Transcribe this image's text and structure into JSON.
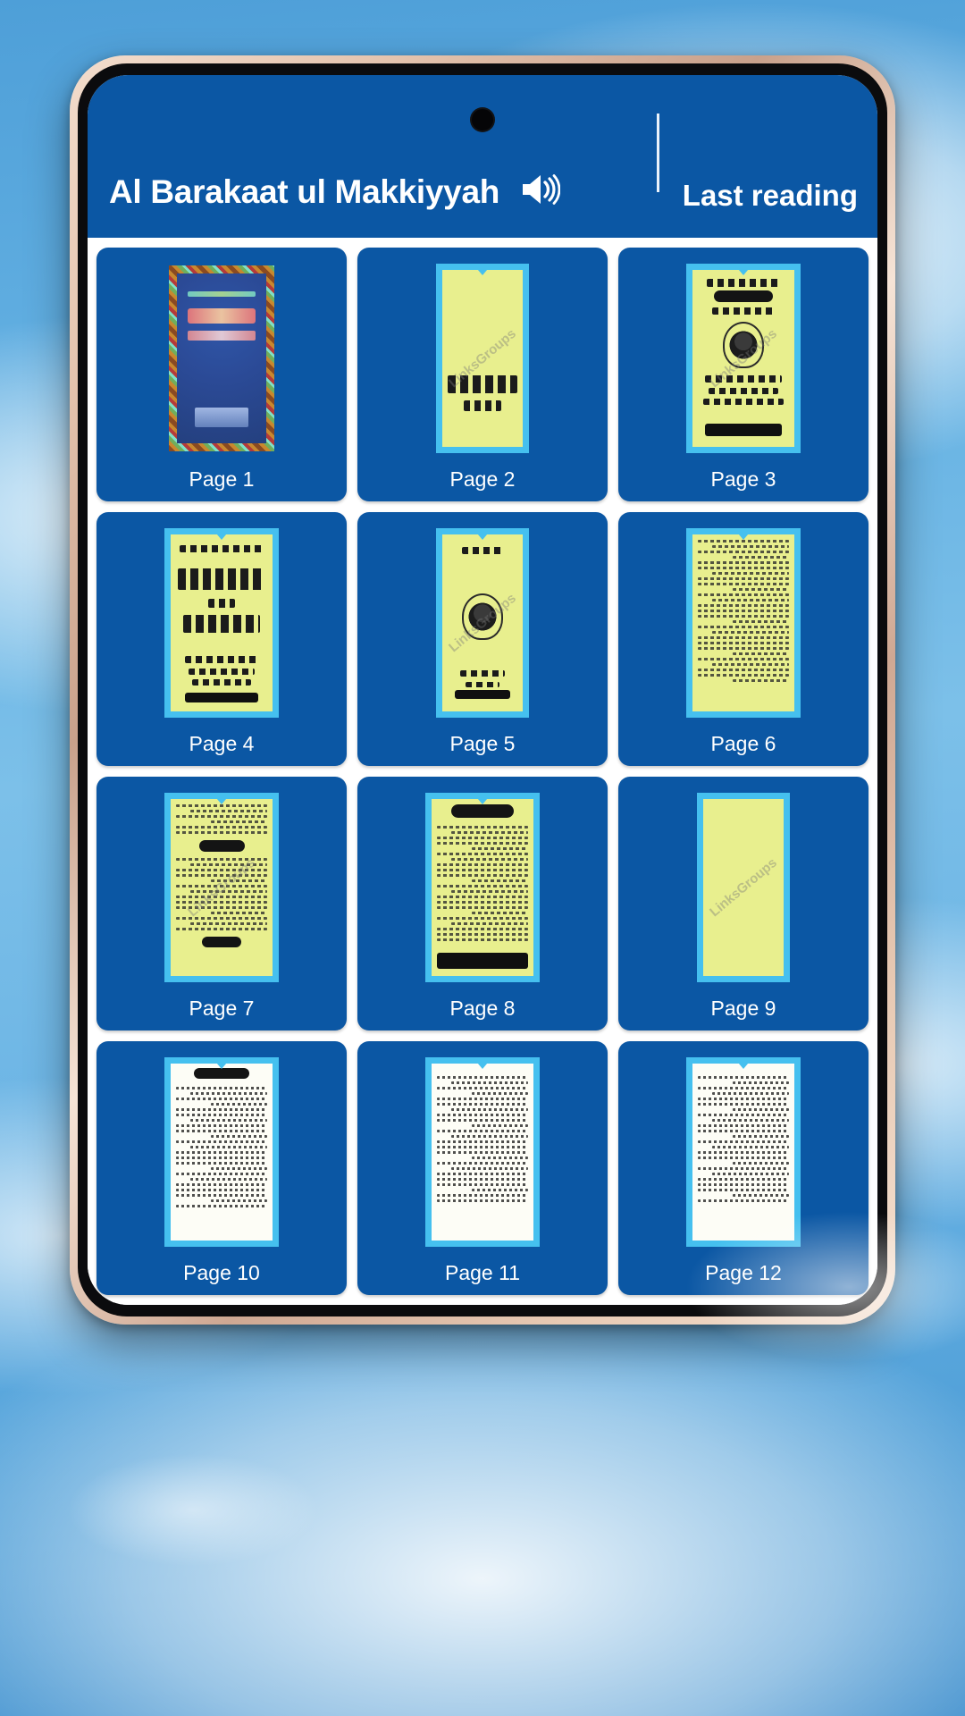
{
  "app": {
    "title": "Al Barakaat ul Makkiyyah",
    "speaker_icon": "speaker-icon",
    "last_reading_label": "Last reading",
    "header_bg": "#0b57a4",
    "card_bg": "#0b57a4",
    "label_color": "#ffffff",
    "page_bg": "#ffffff"
  },
  "grid": {
    "columns": 3,
    "items": [
      {
        "label": "Page 1",
        "thumb": "ornate-book-cover",
        "watermark": ""
      },
      {
        "label": "Page 2",
        "thumb": "title-page-sparse",
        "watermark": "LinksGroups"
      },
      {
        "label": "Page 3",
        "thumb": "emblem-title-page",
        "watermark": "LinksGroups"
      },
      {
        "label": "Page 4",
        "thumb": "arabic-title-page",
        "watermark": ""
      },
      {
        "label": "Page 5",
        "thumb": "emblem-page",
        "watermark": "LinksGroups"
      },
      {
        "label": "Page 6",
        "thumb": "dense-text-page",
        "watermark": ""
      },
      {
        "label": "Page 7",
        "thumb": "text-page-heading",
        "watermark": "LinksGroups"
      },
      {
        "label": "Page 8",
        "thumb": "text-page-banner",
        "watermark": ""
      },
      {
        "label": "Page 9",
        "thumb": "blank-page",
        "watermark": "LinksGroups"
      },
      {
        "label": "Page 10",
        "thumb": "index-page",
        "watermark": ""
      },
      {
        "label": "Page 11",
        "thumb": "text-page-white",
        "watermark": ""
      },
      {
        "label": "Page 12",
        "thumb": "text-page-white",
        "watermark": ""
      }
    ]
  }
}
